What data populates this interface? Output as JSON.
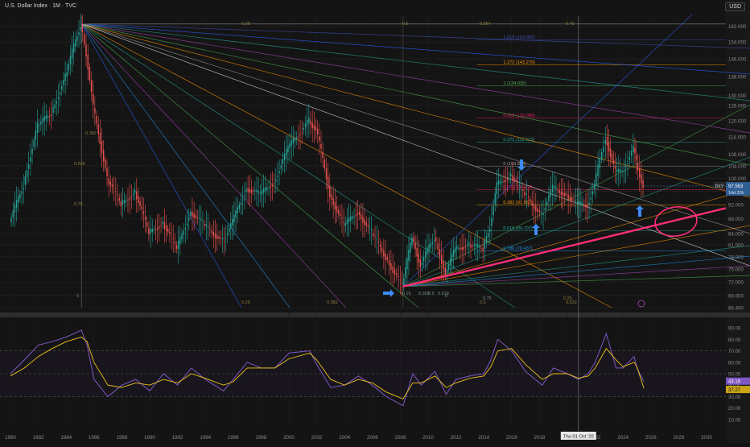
{
  "header": {
    "title": "U.S. Dollar Index · 1M · TVC",
    "currency": "USD"
  },
  "colors": {
    "background": "#141414",
    "grid": "#232323",
    "candle_up": "#26a69a",
    "candle_down": "#ef5350",
    "pink": "#ff2d78",
    "arrow": "#3d8bfd",
    "rsi": "#7e57c2",
    "rsi_ma": "#f0c419",
    "axis_text": "#8a8a8a"
  },
  "price_axis": {
    "ticks": [
      "162.000",
      "154.000",
      "146.000",
      "138.000",
      "130.000",
      "126.000",
      "120.000",
      "114.000",
      "108.000",
      "104.000",
      "100.000",
      "96.000",
      "92.000",
      "88.000",
      "84.000",
      "81.000",
      "78.000",
      "75.000",
      "72.000",
      "69.000",
      "66.400"
    ],
    "last_label": "DXY",
    "last_value": "97.563",
    "countdown": "14d 22h"
  },
  "rsi_axis": {
    "ticks": [
      "90.00",
      "80.00",
      "70.00",
      "60.00",
      "50.00",
      "40.00",
      "30.00",
      "20.00",
      "10.00"
    ],
    "rsi_value": "43.19",
    "ma_value": "37.27"
  },
  "time_axis": {
    "ticks": [
      "1980",
      "1982",
      "1984",
      "1986",
      "1988",
      "1990",
      "1992",
      "1994",
      "1996",
      "1998",
      "2000",
      "2002",
      "2004",
      "2006",
      "2008",
      "2010",
      "2012",
      "2014",
      "2016",
      "2018",
      "2020",
      "2022",
      "2024",
      "2026",
      "2028",
      "2030"
    ],
    "crosshair_label": "Thu 01 Oct '20"
  },
  "fib_labels": [
    "1.618 (154.950)",
    "1.272 (143.270)",
    "1 (134.035)",
    "0.618 (120.989)",
    "0.272 (112.113)",
    "0 (103.816)",
    "0.236 (96.450)",
    "0.382 (91.967)",
    "0.618 (84.707)",
    "0.786 (79.437)"
  ],
  "fan_labels": [
    "0.25",
    "0.5",
    "0.364",
    "0.75",
    "0.382",
    "0.636",
    "0.75",
    "0.25",
    "0.382",
    "0.5",
    "0.632",
    "0.25"
  ],
  "bottom_labels": [
    "0",
    "0.25",
    "0.382",
    "0.5",
    "0.618",
    "0.75",
    "0"
  ],
  "chart_data": [
    {
      "type": "candlestick",
      "title": "U.S. Dollar Index · 1M · TVC",
      "x_range": [
        "1980",
        "2031"
      ],
      "ylim": [
        66.4,
        168
      ],
      "x": [
        1980.0,
        1981.0,
        1982.0,
        1983.0,
        1984.0,
        1985.1,
        1985.5,
        1986.0,
        1987.0,
        1988.0,
        1989.0,
        1990.0,
        1991.0,
        1992.0,
        1993.0,
        1994.0,
        1995.3,
        1996.0,
        1997.0,
        1998.0,
        1999.0,
        2000.0,
        2001.5,
        2002.0,
        2003.0,
        2004.0,
        2005.0,
        2006.0,
        2007.0,
        2008.2,
        2008.9,
        2009.5,
        2010.5,
        2011.3,
        2012.0,
        2013.0,
        2014.0,
        2014.5,
        2015.0,
        2016.0,
        2017.0,
        2018.2,
        2019.0,
        2020.0,
        2020.8,
        2021.5,
        2022.0,
        2022.8,
        2023.5,
        2024.0,
        2024.8,
        2025.0,
        2025.5
      ],
      "values": [
        87,
        98,
        118,
        123,
        138,
        163,
        148,
        125,
        100,
        92,
        96,
        84,
        87,
        80,
        90,
        86,
        82,
        87,
        97,
        95,
        99,
        110,
        120,
        117,
        95,
        86,
        90,
        84,
        78,
        71,
        83,
        76,
        83,
        74,
        80,
        81,
        80,
        86,
        98,
        101,
        95,
        89,
        97,
        95,
        92,
        92,
        98,
        114,
        102,
        102,
        110,
        105,
        97.6
      ],
      "ylabel": ""
    },
    {
      "type": "line",
      "title": "",
      "ylim": [
        0,
        100
      ],
      "series": [
        {
          "name": "RSI",
          "values": [
            50,
            62,
            75,
            78,
            82,
            88,
            75,
            45,
            30,
            40,
            45,
            35,
            50,
            40,
            55,
            45,
            35,
            45,
            60,
            55,
            55,
            68,
            70,
            58,
            38,
            40,
            48,
            40,
            30,
            22,
            50,
            40,
            52,
            32,
            45,
            48,
            50,
            62,
            80,
            70,
            52,
            40,
            55,
            50,
            45,
            50,
            60,
            85,
            55,
            55,
            65,
            55,
            43.19
          ]
        },
        {
          "name": "MA",
          "values": [
            48,
            55,
            65,
            72,
            78,
            82,
            78,
            60,
            40,
            38,
            42,
            40,
            45,
            42,
            50,
            46,
            40,
            43,
            55,
            55,
            55,
            63,
            68,
            62,
            45,
            40,
            45,
            42,
            34,
            28,
            42,
            42,
            48,
            38,
            42,
            46,
            48,
            56,
            70,
            72,
            58,
            45,
            50,
            50,
            46,
            48,
            55,
            72,
            62,
            56,
            60,
            56,
            37.27
          ]
        }
      ],
      "x": [
        1980.0,
        1981.0,
        1982.0,
        1983.0,
        1984.0,
        1985.1,
        1985.5,
        1986.0,
        1987.0,
        1988.0,
        1989.0,
        1990.0,
        1991.0,
        1992.0,
        1993.0,
        1994.0,
        1995.3,
        1996.0,
        1997.0,
        1998.0,
        1999.0,
        2000.0,
        2001.5,
        2002.0,
        2003.0,
        2004.0,
        2005.0,
        2006.0,
        2007.0,
        2008.2,
        2008.9,
        2009.5,
        2010.5,
        2011.3,
        2012.0,
        2013.0,
        2014.0,
        2014.5,
        2015.0,
        2016.0,
        2017.0,
        2018.2,
        2019.0,
        2020.0,
        2020.8,
        2021.5,
        2022.0,
        2022.8,
        2023.5,
        2024.0,
        2024.8,
        2025.0,
        2025.5
      ],
      "ylabel": "",
      "xlabel": ""
    }
  ]
}
